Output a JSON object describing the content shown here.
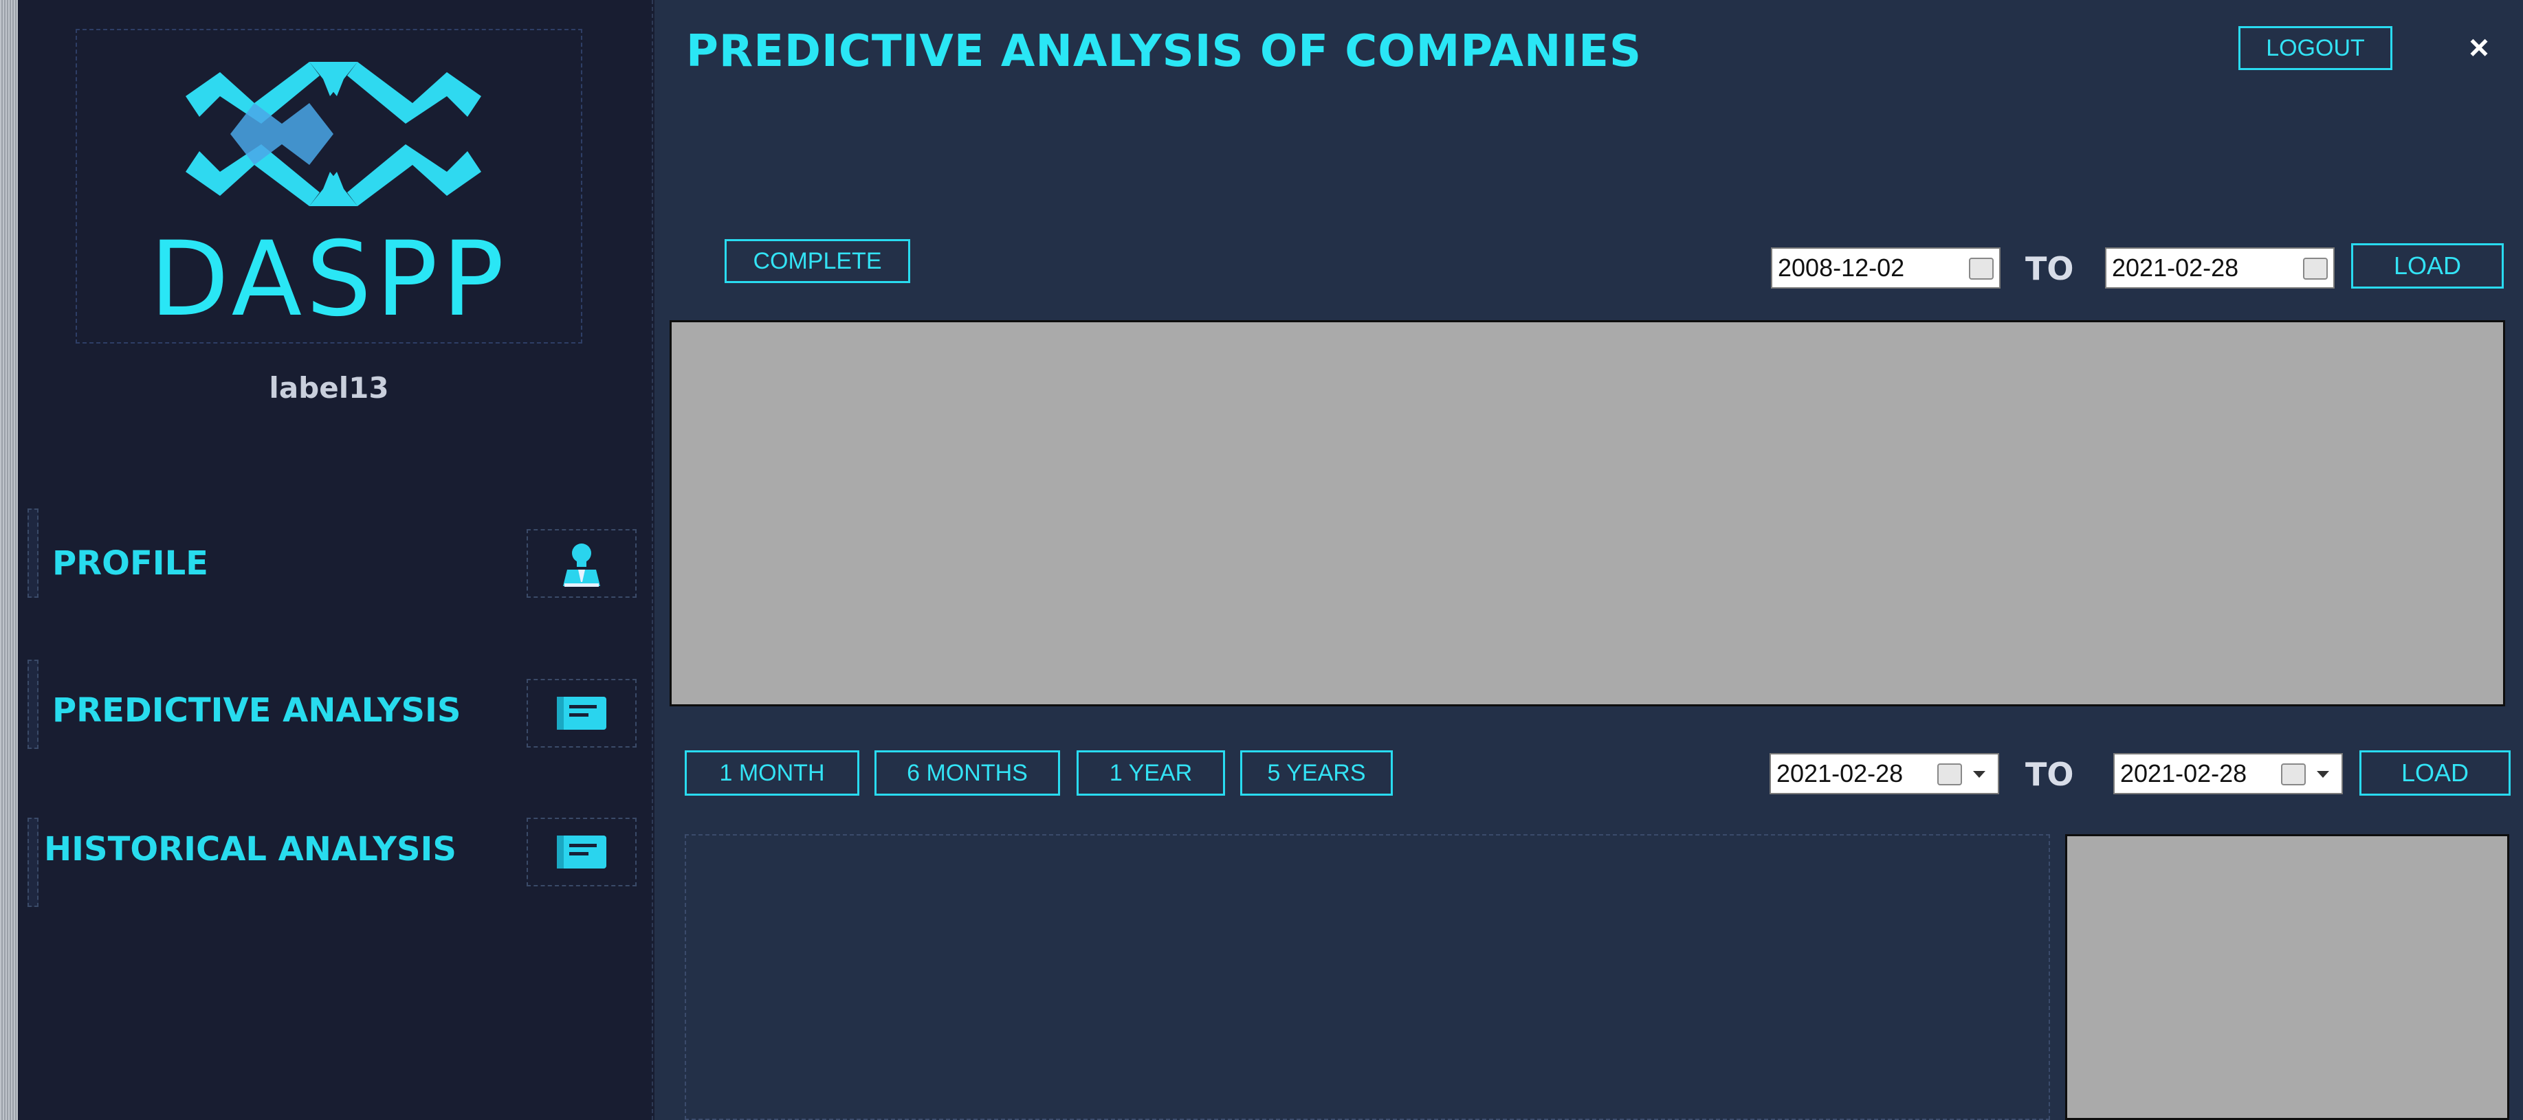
{
  "app": {
    "logo_text": "DASPP",
    "user_label": "label13",
    "title": "PREDICTIVE ANALYSIS OF COMPANIES",
    "logout_label": "LOGOUT",
    "close_glyph": "×"
  },
  "sidebar": {
    "items": [
      {
        "label": "PROFILE",
        "icon": "user-icon"
      },
      {
        "label": "PREDICTIVE ANALYSIS",
        "icon": "message-icon"
      },
      {
        "label": "HISTORICAL ANALYSIS",
        "icon": "message-icon"
      }
    ]
  },
  "top_section": {
    "complete_label": "COMPLETE",
    "from_date": "2008-12-02",
    "to_label": "TO",
    "to_date": "2021-02-28",
    "load_label": "LOAD"
  },
  "bottom_section": {
    "range_buttons": [
      "1 MONTH",
      "6 MONTHS",
      "1 YEAR",
      "5 YEARS"
    ],
    "from_date": "2021-02-28",
    "to_label": "TO",
    "to_date": "2021-02-28",
    "load_label": "LOAD"
  },
  "colors": {
    "accent": "#2ae6f5",
    "main_bg": "#233048",
    "sidebar_bg": "#181d31",
    "panel_gray": "#aaaaaa"
  }
}
